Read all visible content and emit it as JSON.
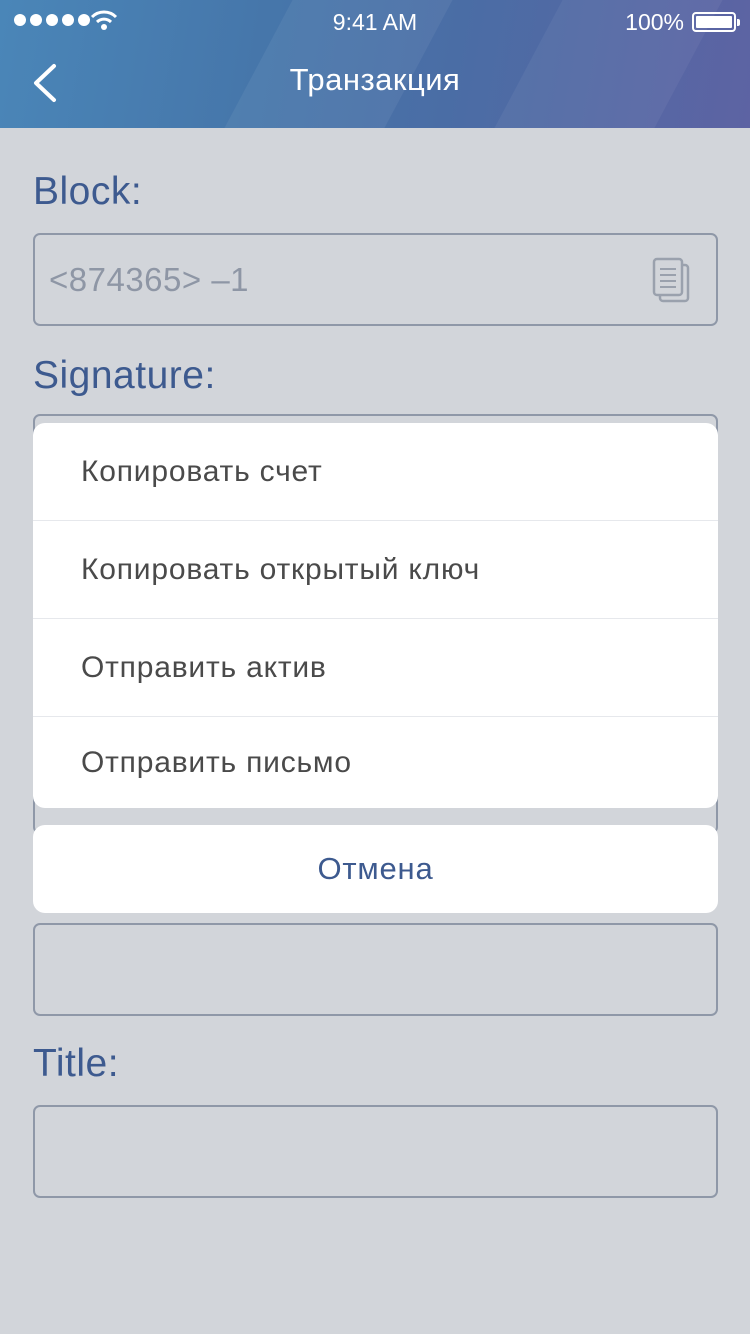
{
  "status_bar": {
    "time": "9:41 AM",
    "battery": "100%",
    "signal_icon": "signal-dots-icon",
    "wifi_icon": "wifi-icon",
    "battery_icon": "battery-icon"
  },
  "nav": {
    "title": "Транзакция",
    "back_icon": "chevron-left-icon"
  },
  "form": {
    "block_label": "Block:",
    "block_value": "<874365> –1",
    "copy_icon": "copy-icon",
    "signature_label": "Signature:",
    "title_label": "Title:"
  },
  "action_sheet": {
    "items": [
      "Копировать счет",
      "Копировать открытый ключ",
      "Отправить актив",
      "Отправить письмо"
    ],
    "cancel": "Отмена"
  },
  "colors": {
    "accent": "#3d5a8f",
    "background": "#d2d5da",
    "header_start": "#4a86b8",
    "header_end": "#5d63a3"
  }
}
